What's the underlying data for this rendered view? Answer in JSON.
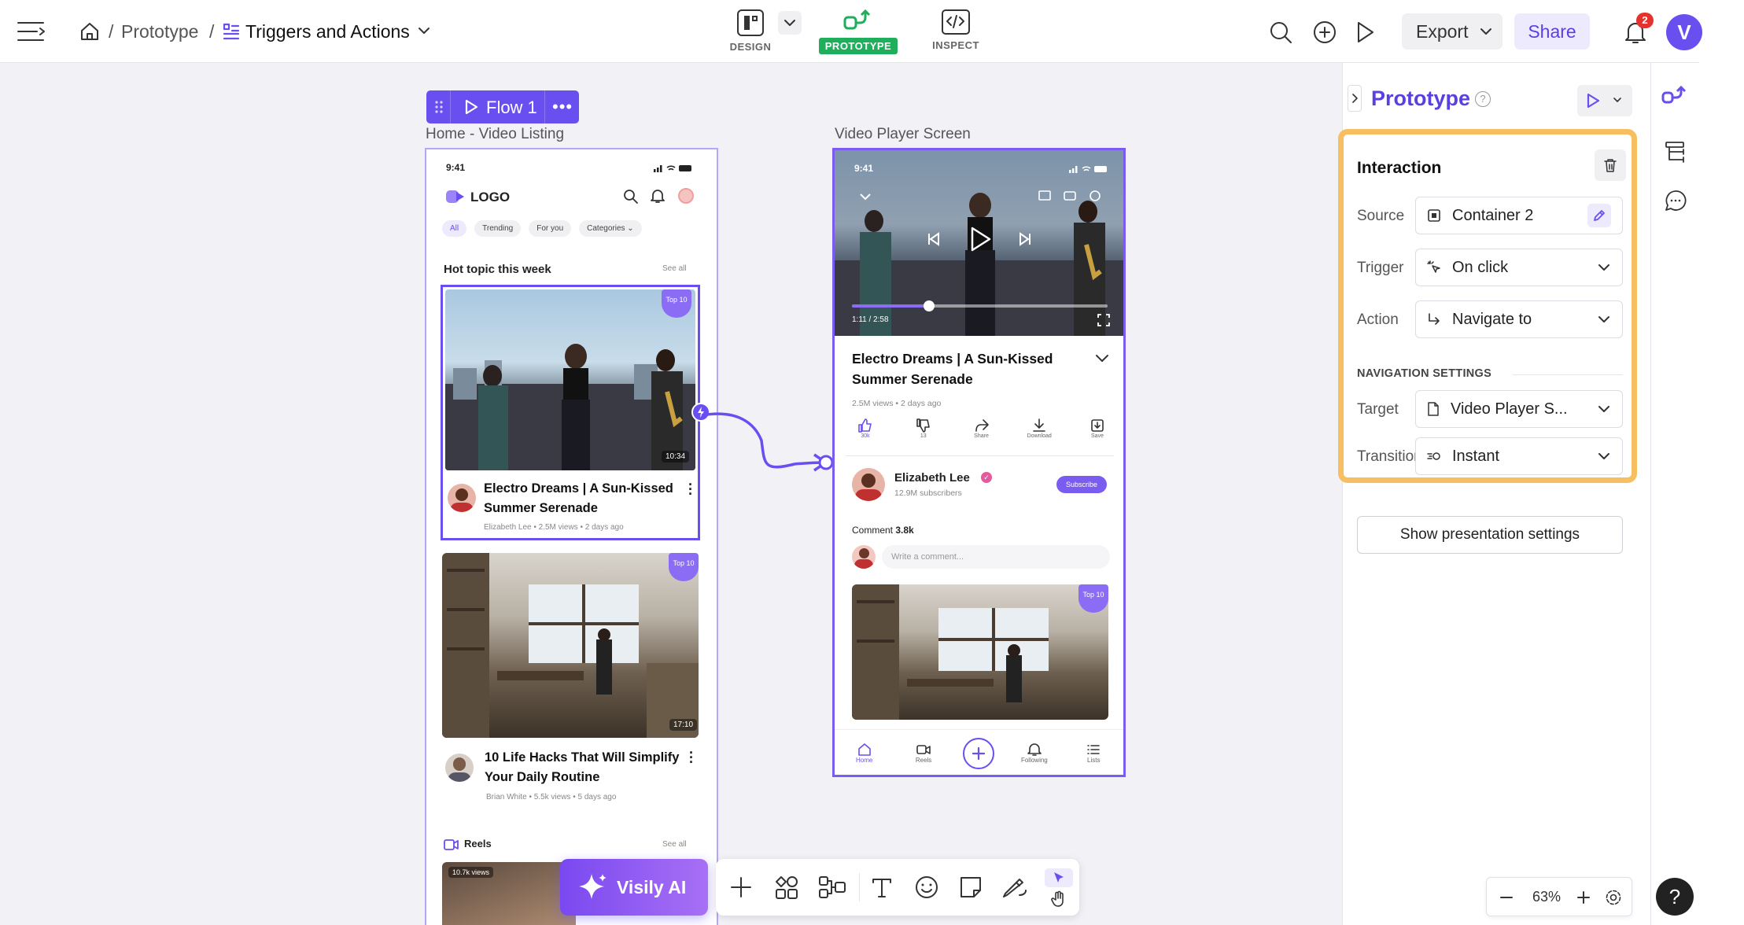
{
  "header": {
    "breadcrumb_root": "Prototype",
    "breadcrumb_sep": "/",
    "breadcrumb_page": "Triggers and Actions",
    "modes": [
      {
        "label": "DESIGN"
      },
      {
        "label": "PROTOTYPE"
      },
      {
        "label": "INSPECT"
      }
    ],
    "export_label": "Export",
    "share_label": "Share",
    "notification_count": "2",
    "avatar_letter": "V"
  },
  "canvas": {
    "flow_label": "Flow 1",
    "frame_left_title": "Home - Video Listing",
    "frame_right_title": "Video Player Screen"
  },
  "home_screen": {
    "time": "9:41",
    "logo": "LOGO",
    "chips": [
      "All",
      "Trending",
      "For you",
      "Categories"
    ],
    "section_title": "Hot topic this week",
    "see_all": "See all",
    "video1": {
      "badge": "Top 10",
      "duration": "10:34",
      "title_line1": "Electro Dreams | A Sun-Kissed",
      "title_line2": "Summer Serenade",
      "meta": "Elizabeth Lee • 2.5M views • 2 days ago"
    },
    "video2": {
      "badge": "Top 10",
      "duration": "17:10",
      "title_line1": "10 Life Hacks That Will Simplify",
      "title_line2": "Your Daily Routine",
      "meta": "Brian White • 5.5k views • 5 days ago"
    },
    "reels_title": "Reels",
    "reels_see_all": "See all",
    "reel_views": "10.7k views"
  },
  "player_screen": {
    "time": "9:41",
    "progress_time": "1:11 / 2:58",
    "progress_fraction": 0.3,
    "title_line1": "Electro Dreams | A Sun-Kissed",
    "title_line2": "Summer Serenade",
    "meta": "2.5M views • 2 days ago",
    "actions": [
      {
        "label": "30k"
      },
      {
        "label": "13"
      },
      {
        "label": "Share"
      },
      {
        "label": "Download"
      },
      {
        "label": "Save"
      }
    ],
    "channel_name": "Elizabeth Lee",
    "subscribers": "12.9M subscribers",
    "subscribe_label": "Subscribe",
    "comments_label": "Comment",
    "comments_count": "3.8k",
    "comment_placeholder": "Write a comment...",
    "next_badge": "Top 10",
    "nav": [
      {
        "label": "Home"
      },
      {
        "label": "Reels"
      },
      {
        "label": ""
      },
      {
        "label": "Following"
      },
      {
        "label": "Lists"
      }
    ]
  },
  "toolbar": {
    "ai_label": "Visily AI"
  },
  "panel": {
    "title": "Prototype",
    "interaction_title": "Interaction",
    "source_label": "Source",
    "source_value": "Container 2",
    "trigger_label": "Trigger",
    "trigger_value": "On click",
    "action_label": "Action",
    "action_value": "Navigate to",
    "nav_settings_title": "NAVIGATION SETTINGS",
    "target_label": "Target",
    "target_value": "Video Player S...",
    "transition_label": "Transition",
    "transition_value": "Instant",
    "presentation_button": "Show presentation settings",
    "zoom": "63%",
    "help": "?"
  },
  "colors": {
    "accent": "#6a4ff0",
    "prototype_green": "#1fae5b",
    "highlight_orange": "#f7bf62",
    "notification_red": "#e5322d"
  }
}
